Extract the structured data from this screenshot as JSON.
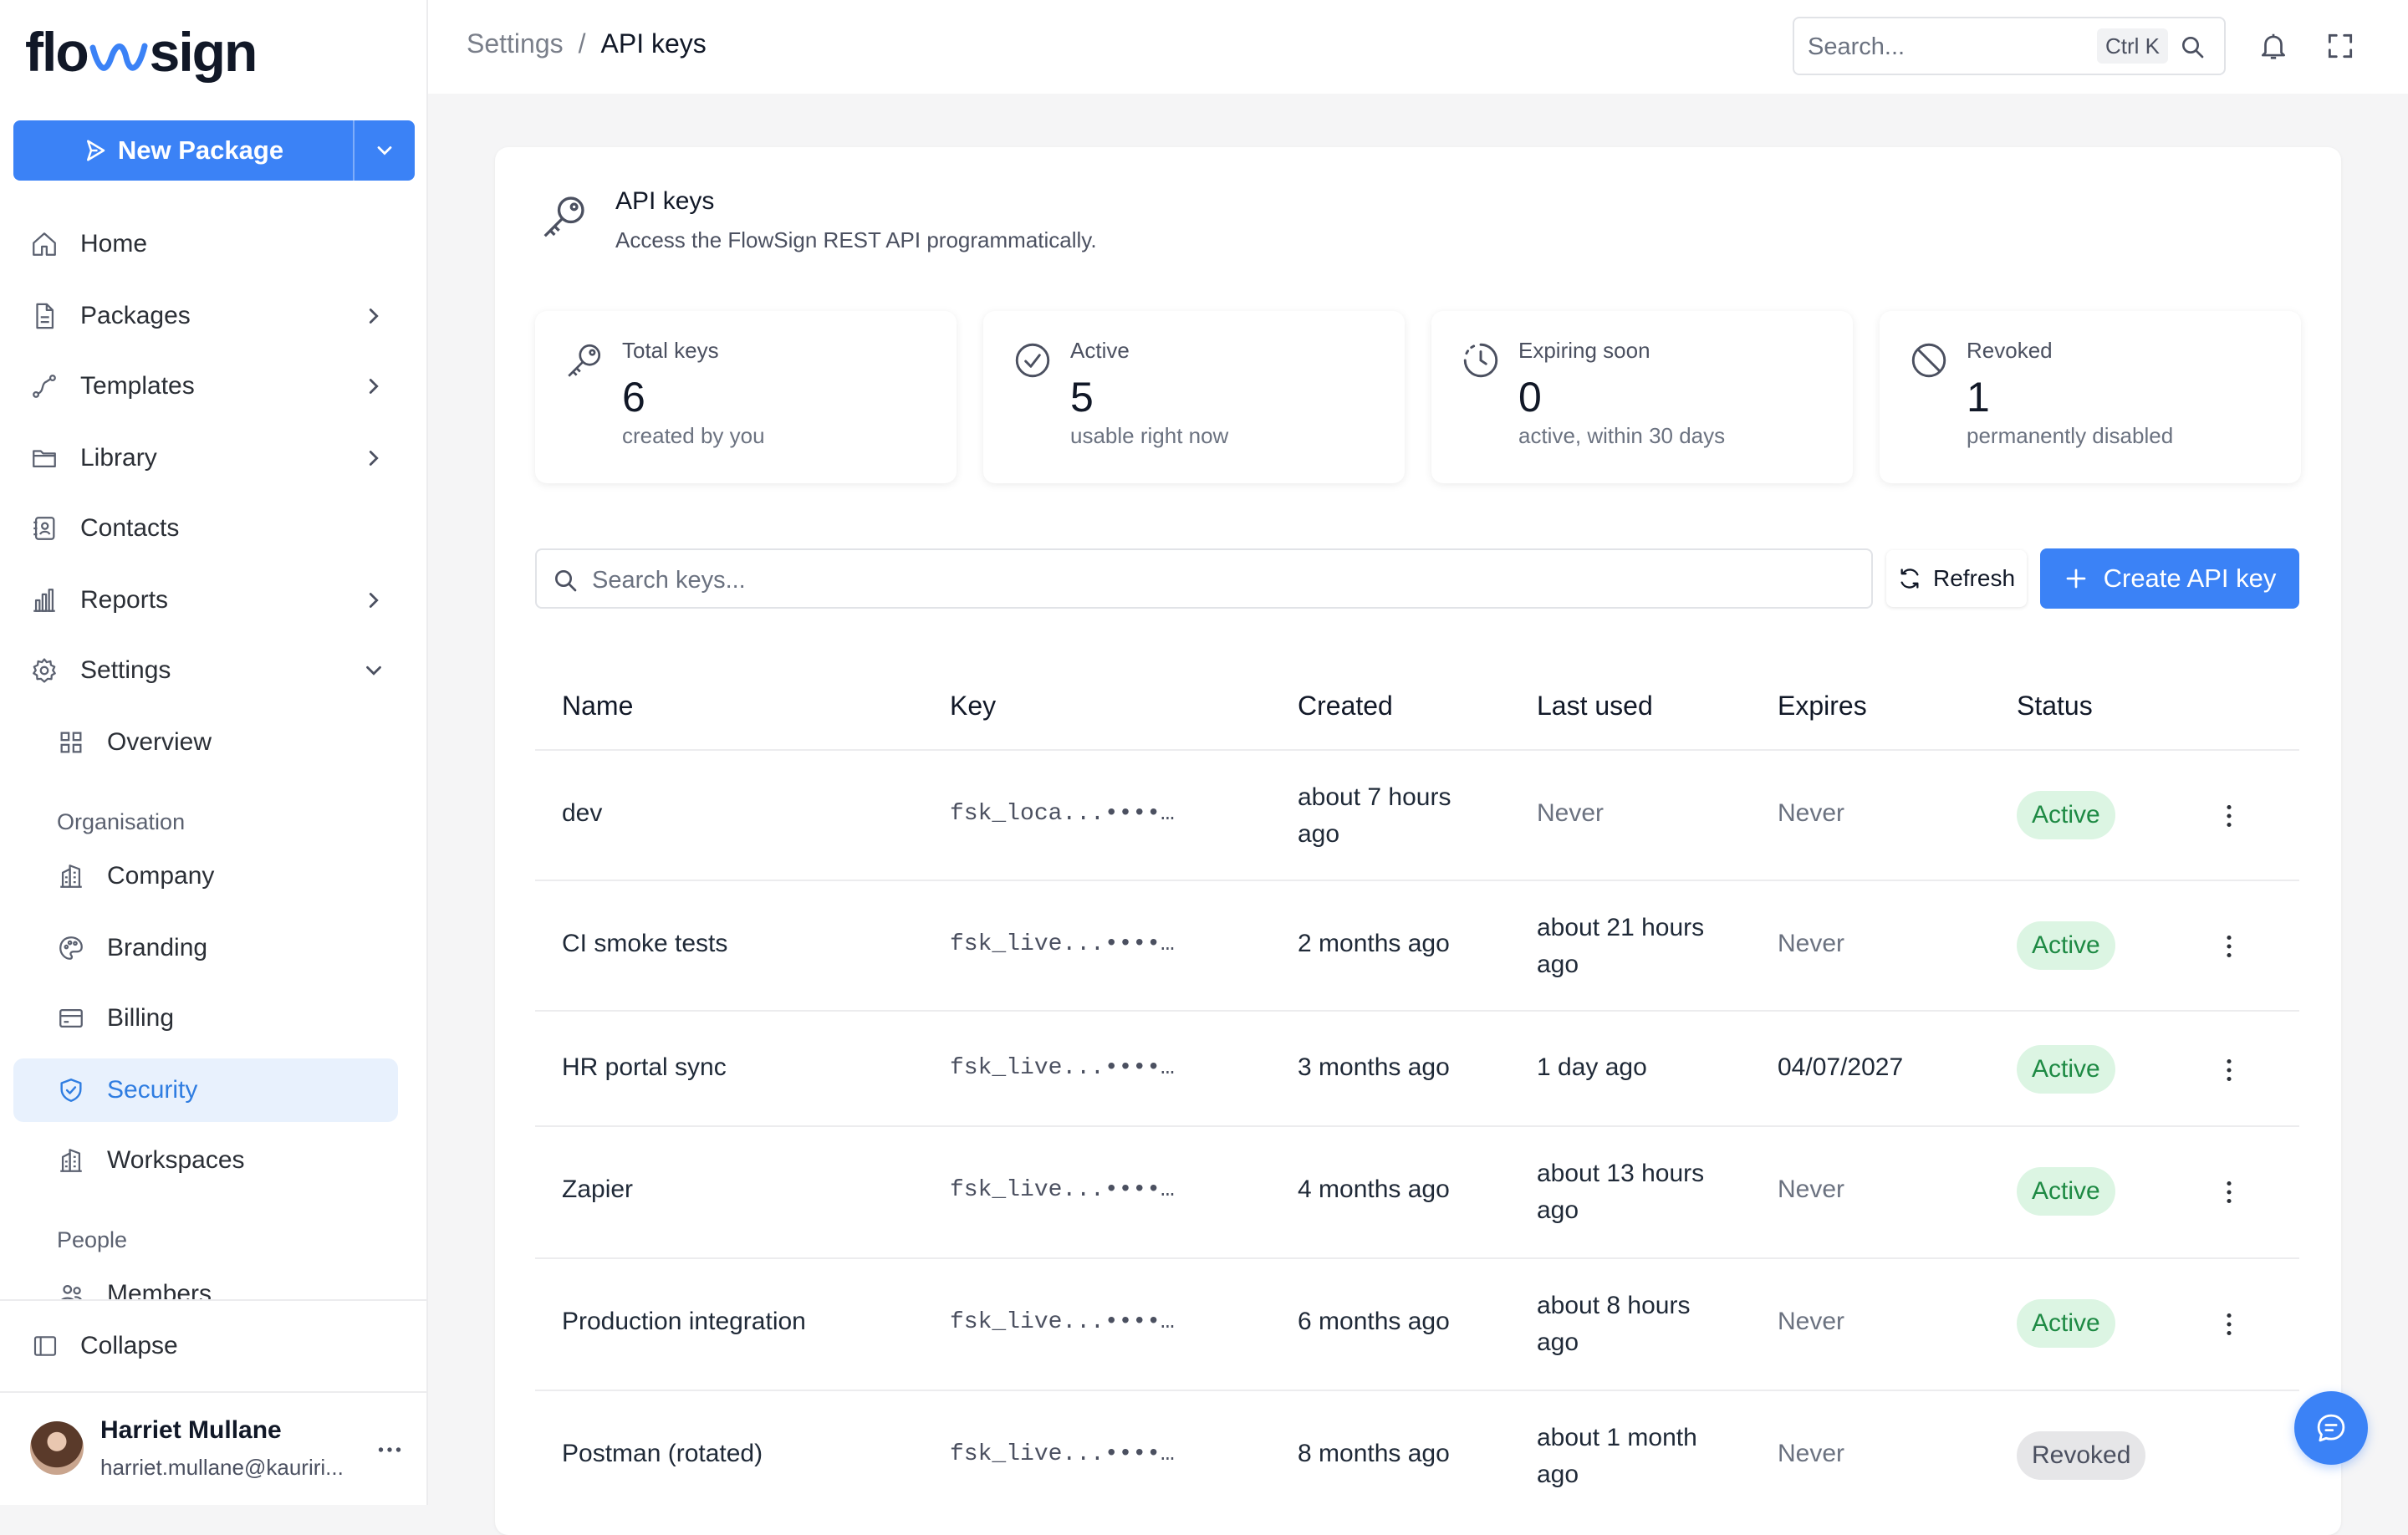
{
  "app": {
    "logo_left": "flo",
    "logo_right": "sign",
    "new_package_label": "New Package"
  },
  "sidebar": {
    "items": [
      {
        "label": "Home",
        "icon": "home-icon"
      },
      {
        "label": "Packages",
        "icon": "document-icon"
      },
      {
        "label": "Templates",
        "icon": "route-icon"
      },
      {
        "label": "Library",
        "icon": "folder-icon"
      },
      {
        "label": "Contacts",
        "icon": "contact-book-icon"
      },
      {
        "label": "Reports",
        "icon": "bar-chart-icon"
      },
      {
        "label": "Settings",
        "icon": "gear-icon"
      }
    ],
    "settings_children": {
      "overview": "Overview",
      "organisation_heading": "Organisation",
      "company": "Company",
      "branding": "Branding",
      "billing": "Billing",
      "security": "Security",
      "workspaces": "Workspaces",
      "people_heading": "People",
      "members": "Members"
    },
    "collapse_label": "Collapse",
    "user": {
      "name": "Harriet Mullane",
      "email": "harriet.mullane@kauriri..."
    }
  },
  "header": {
    "breadcrumb_parent": "Settings",
    "breadcrumb_sep": "/",
    "breadcrumb_current": "API keys",
    "search_placeholder": "Search...",
    "search_shortcut": "Ctrl K"
  },
  "page": {
    "title": "API keys",
    "subtitle": "Access the FlowSign REST API programmatically."
  },
  "stats": [
    {
      "label": "Total keys",
      "value": "6",
      "desc": "created by you",
      "icon": "key-icon"
    },
    {
      "label": "Active",
      "value": "5",
      "desc": "usable right now",
      "icon": "check-circle-icon"
    },
    {
      "label": "Expiring soon",
      "value": "0",
      "desc": "active, within 30 days",
      "icon": "clock-icon"
    },
    {
      "label": "Revoked",
      "value": "1",
      "desc": "permanently disabled",
      "icon": "ban-icon"
    }
  ],
  "toolbar": {
    "search_placeholder": "Search keys...",
    "refresh_label": "Refresh",
    "create_label": "Create API key"
  },
  "table": {
    "columns": [
      "Name",
      "Key",
      "Created",
      "Last used",
      "Expires",
      "Status"
    ],
    "rows": [
      {
        "name": "dev",
        "key": "fsk_loca...••••…",
        "created": "about 7 hours ago",
        "last_used": "Never",
        "expires": "Never",
        "status": "Active"
      },
      {
        "name": "CI smoke tests",
        "key": "fsk_live...••••…",
        "created": "2 months ago",
        "last_used": "about 21 hours ago",
        "expires": "Never",
        "status": "Active"
      },
      {
        "name": "HR portal sync",
        "key": "fsk_live...••••…",
        "created": "3 months ago",
        "last_used": "1 day ago",
        "expires": "04/07/2027",
        "status": "Active"
      },
      {
        "name": "Zapier",
        "key": "fsk_live...••••…",
        "created": "4 months ago",
        "last_used": "about 13 hours ago",
        "expires": "Never",
        "status": "Active"
      },
      {
        "name": "Production integration",
        "key": "fsk_live...••••…",
        "created": "6 months ago",
        "last_used": "about 8 hours ago",
        "expires": "Never",
        "status": "Active"
      },
      {
        "name": "Postman (rotated)",
        "key": "fsk_live...••••…",
        "created": "8 months ago",
        "last_used": "about 1 month ago",
        "expires": "Never",
        "status": "Revoked"
      }
    ]
  },
  "colors": {
    "accent": "#3b82f6",
    "active_badge_bg": "#dcf5e3",
    "active_badge_text": "#1e8a44",
    "revoked_badge_bg": "#e6e6e8",
    "nav_active_bg": "#e8f1fd"
  }
}
